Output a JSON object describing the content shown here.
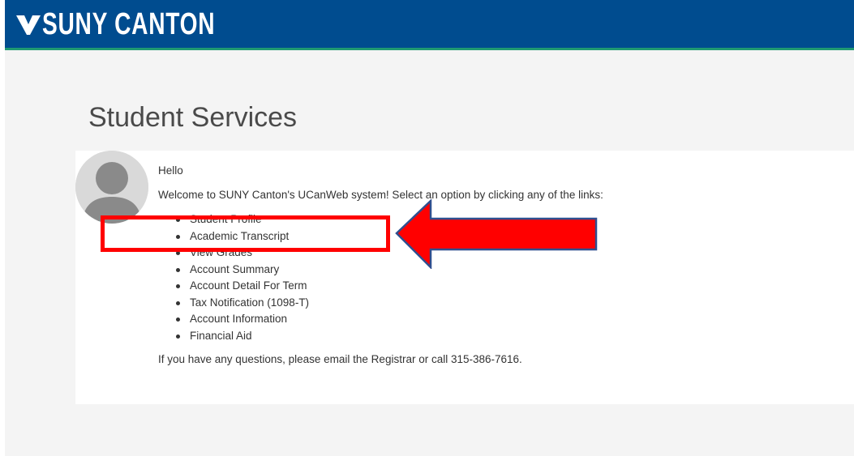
{
  "header": {
    "logo_text": "SUNY CANTON",
    "bar_color": "#004c8f",
    "accent_color": "#1f9a72"
  },
  "page": {
    "title": "Student Services"
  },
  "greeting": {
    "hello": "Hello",
    "welcome": "Welcome to SUNY Canton's UCanWeb system! Select an option by clicking any of the links:"
  },
  "menu": {
    "items": [
      {
        "label": "Student Profile"
      },
      {
        "label": "Academic Transcript"
      },
      {
        "label": "View Grades"
      },
      {
        "label": "Account Summary"
      },
      {
        "label": "Account Detail For Term"
      },
      {
        "label": "Tax Notification (1098-T)"
      },
      {
        "label": "Account Information"
      },
      {
        "label": "Financial Aid"
      }
    ]
  },
  "footer_note": {
    "prefix": "If you have any questions, please",
    "link": "email the Registrar",
    "suffix": "or call 315-386-7616."
  },
  "annotation": {
    "highlight_color": "#ff0000",
    "arrow_border_color": "#2f4f8f"
  }
}
